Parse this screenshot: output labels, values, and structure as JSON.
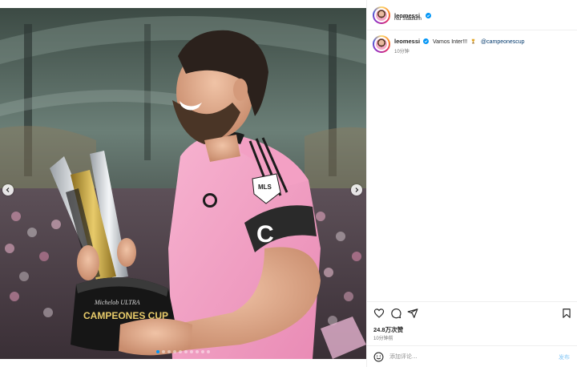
{
  "post": {
    "author": "leomessi",
    "location": "Nu Stadium",
    "caption_text": "Vamos Inter!!!",
    "caption_mention": "@campeonescup",
    "caption_time": "10分钟",
    "likes": "24.8万次赞",
    "post_time": "10分钟前"
  },
  "media": {
    "trophy_lines": [
      "Michelob ULTRA",
      "CAMPEONES CUP"
    ],
    "sleeve_badge": "MLS",
    "armband_letter": "C",
    "carousel": {
      "total": 10,
      "active": 1
    }
  },
  "comment": {
    "placeholder": "添加评论...",
    "post_label": "发布"
  },
  "colors": {
    "jersey": "#f5a3c7",
    "link": "#00376b",
    "post_button": "#85c7f5",
    "verified": "#0095f6"
  }
}
